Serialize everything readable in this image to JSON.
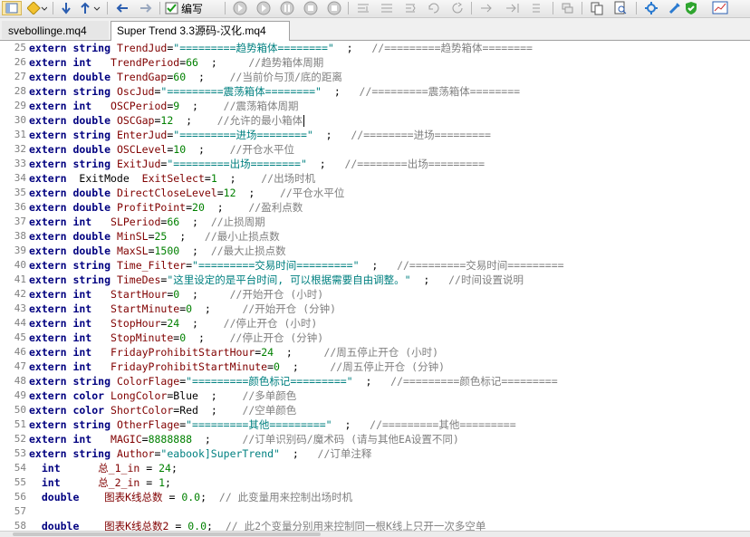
{
  "toolbar": {
    "compile_label": "编写",
    "icons": [
      "navigator-icon",
      "bookmark-icon",
      "arrow-down-icon",
      "arrow-updown-icon",
      "back-icon",
      "forward-icon",
      "compile-icon",
      "run-icon",
      "play-icon",
      "pause-icon",
      "stop-icon",
      "step-into-icon",
      "step-over-icon",
      "step-out-icon",
      "breakpoint-icon",
      "run-to-cursor-icon",
      "copy-icon",
      "search-file-icon",
      "settings-icon",
      "shield-check-icon",
      "chart-icon"
    ]
  },
  "tabs": [
    {
      "label": "svebollinge.mq4",
      "active": false
    },
    {
      "label": "Super Trend 3.3源码-汉化.mq4",
      "active": true
    }
  ],
  "editor": {
    "lines": [
      {
        "n": "25",
        "t": [
          [
            "kw",
            "extern string "
          ],
          [
            "id",
            "TrendJud"
          ],
          [
            "eq",
            "="
          ],
          [
            "str",
            "\"=========趋势箱体========\""
          ],
          [
            "plain",
            "  ;   "
          ],
          [
            "cm",
            "//=========趋势箱体========"
          ]
        ]
      },
      {
        "n": "26",
        "t": [
          [
            "kw",
            "extern int   "
          ],
          [
            "id",
            "TrendPeriod"
          ],
          [
            "eq",
            "="
          ],
          [
            "num",
            "66"
          ],
          [
            "plain",
            "  ;     "
          ],
          [
            "cm",
            "//趋势箱体周期"
          ]
        ]
      },
      {
        "n": "27",
        "t": [
          [
            "kw",
            "extern double "
          ],
          [
            "id",
            "TrendGap"
          ],
          [
            "eq",
            "="
          ],
          [
            "num",
            "60"
          ],
          [
            "plain",
            "  ;    "
          ],
          [
            "cm",
            "//当前价与顶/底的距离"
          ]
        ]
      },
      {
        "n": "28",
        "t": [
          [
            "kw",
            "extern string "
          ],
          [
            "id",
            "OscJud"
          ],
          [
            "eq",
            "="
          ],
          [
            "str",
            "\"=========震荡箱体========\""
          ],
          [
            "plain",
            "  ;   "
          ],
          [
            "cm",
            "//=========震荡箱体========"
          ]
        ]
      },
      {
        "n": "29",
        "t": [
          [
            "kw",
            "extern int   "
          ],
          [
            "id",
            "OSCPeriod"
          ],
          [
            "eq",
            "="
          ],
          [
            "num",
            "9"
          ],
          [
            "plain",
            "  ;    "
          ],
          [
            "cm",
            "//震荡箱体周期"
          ]
        ]
      },
      {
        "n": "30",
        "t": [
          [
            "kw",
            "extern double "
          ],
          [
            "id",
            "OSCGap"
          ],
          [
            "eq",
            "="
          ],
          [
            "num",
            "12"
          ],
          [
            "plain",
            "  ;    "
          ],
          [
            "cm",
            "//允许的最小箱体"
          ]
        ]
      },
      {
        "n": "31",
        "t": [
          [
            "kw",
            "extern string "
          ],
          [
            "id",
            "EnterJud"
          ],
          [
            "eq",
            "="
          ],
          [
            "str",
            "\"=========进场========\""
          ],
          [
            "plain",
            "  ;   "
          ],
          [
            "cm",
            "//========进场========="
          ]
        ]
      },
      {
        "n": "32",
        "t": [
          [
            "kw",
            "extern double "
          ],
          [
            "id",
            "OSCLevel"
          ],
          [
            "eq",
            "="
          ],
          [
            "num",
            "10"
          ],
          [
            "plain",
            "  ;    "
          ],
          [
            "cm",
            "//开仓水平位"
          ]
        ]
      },
      {
        "n": "33",
        "t": [
          [
            "kw",
            "extern string "
          ],
          [
            "id",
            "ExitJud"
          ],
          [
            "eq",
            "="
          ],
          [
            "str",
            "\"=========出场========\""
          ],
          [
            "plain",
            "  ;   "
          ],
          [
            "cm",
            "//========出场========="
          ]
        ]
      },
      {
        "n": "34",
        "t": [
          [
            "kw",
            "extern "
          ],
          [
            "plain",
            " ExitMode  "
          ],
          [
            "id",
            "ExitSelect"
          ],
          [
            "eq",
            "="
          ],
          [
            "num",
            "1"
          ],
          [
            "plain",
            "  ;    "
          ],
          [
            "cm",
            "//出场时机"
          ]
        ]
      },
      {
        "n": "35",
        "t": [
          [
            "kw",
            "extern double "
          ],
          [
            "id",
            "DirectCloseLevel"
          ],
          [
            "eq",
            "="
          ],
          [
            "num",
            "12"
          ],
          [
            "plain",
            "  ;    "
          ],
          [
            "cm",
            "//平仓水平位"
          ]
        ]
      },
      {
        "n": "36",
        "t": [
          [
            "kw",
            "extern double "
          ],
          [
            "id",
            "ProfitPoint"
          ],
          [
            "eq",
            "="
          ],
          [
            "num",
            "20"
          ],
          [
            "plain",
            "  ;    "
          ],
          [
            "cm",
            "//盈利点数"
          ]
        ]
      },
      {
        "n": "37",
        "t": [
          [
            "kw",
            "extern int   "
          ],
          [
            "id",
            "SLPeriod"
          ],
          [
            "eq",
            "="
          ],
          [
            "num",
            "66"
          ],
          [
            "plain",
            "  ;  "
          ],
          [
            "cm",
            "//止损周期"
          ]
        ]
      },
      {
        "n": "38",
        "t": [
          [
            "kw",
            "extern double "
          ],
          [
            "id",
            "MinSL"
          ],
          [
            "eq",
            "="
          ],
          [
            "num",
            "25"
          ],
          [
            "plain",
            "  ;   "
          ],
          [
            "cm",
            "//最小止损点数"
          ]
        ]
      },
      {
        "n": "39",
        "t": [
          [
            "kw",
            "extern double "
          ],
          [
            "id",
            "MaxSL"
          ],
          [
            "eq",
            "="
          ],
          [
            "num",
            "1500"
          ],
          [
            "plain",
            "  ;  "
          ],
          [
            "cm",
            "//最大止损点数"
          ]
        ]
      },
      {
        "n": "40",
        "t": [
          [
            "kw",
            "extern string "
          ],
          [
            "id",
            "Time_Filter"
          ],
          [
            "eq",
            "="
          ],
          [
            "str",
            "\"=========交易时间=========\""
          ],
          [
            "plain",
            "  ;   "
          ],
          [
            "cm",
            "//=========交易时间========="
          ]
        ]
      },
      {
        "n": "41",
        "t": [
          [
            "kw",
            "extern string "
          ],
          [
            "id",
            "TimeDes"
          ],
          [
            "eq",
            "="
          ],
          [
            "str",
            "\"这里设定的是平台时间, 可以根据需要自由调整。\""
          ],
          [
            "plain",
            "  ;   "
          ],
          [
            "cm",
            "//时间设置说明"
          ]
        ]
      },
      {
        "n": "42",
        "t": [
          [
            "kw",
            "extern int   "
          ],
          [
            "id",
            "StartHour"
          ],
          [
            "eq",
            "="
          ],
          [
            "num",
            "0"
          ],
          [
            "plain",
            "  ;     "
          ],
          [
            "cm",
            "//开始开仓 (小时)"
          ]
        ]
      },
      {
        "n": "43",
        "t": [
          [
            "kw",
            "extern int   "
          ],
          [
            "id",
            "StartMinute"
          ],
          [
            "eq",
            "="
          ],
          [
            "num",
            "0"
          ],
          [
            "plain",
            "  ;     "
          ],
          [
            "cm",
            "//开始开仓 (分钟)"
          ]
        ]
      },
      {
        "n": "44",
        "t": [
          [
            "kw",
            "extern int   "
          ],
          [
            "id",
            "StopHour"
          ],
          [
            "eq",
            "="
          ],
          [
            "num",
            "24"
          ],
          [
            "plain",
            "  ;    "
          ],
          [
            "cm",
            "//停止开仓 (小时)"
          ]
        ]
      },
      {
        "n": "45",
        "t": [
          [
            "kw",
            "extern int   "
          ],
          [
            "id",
            "StopMinute"
          ],
          [
            "eq",
            "="
          ],
          [
            "num",
            "0"
          ],
          [
            "plain",
            "  ;    "
          ],
          [
            "cm",
            "//停止开仓 (分钟)"
          ]
        ]
      },
      {
        "n": "46",
        "t": [
          [
            "kw",
            "extern int   "
          ],
          [
            "id",
            "FridayProhibitStartHour"
          ],
          [
            "eq",
            "="
          ],
          [
            "num",
            "24"
          ],
          [
            "plain",
            "  ;     "
          ],
          [
            "cm",
            "//周五停止开仓 (小时)"
          ]
        ]
      },
      {
        "n": "47",
        "t": [
          [
            "kw",
            "extern int   "
          ],
          [
            "id",
            "FridayProhibitStartMinute"
          ],
          [
            "eq",
            "="
          ],
          [
            "num",
            "0"
          ],
          [
            "plain",
            "  ;     "
          ],
          [
            "cm",
            "//周五停止开仓 (分钟)"
          ]
        ]
      },
      {
        "n": "48",
        "t": [
          [
            "kw",
            "extern string "
          ],
          [
            "id",
            "ColorFlage"
          ],
          [
            "eq",
            "="
          ],
          [
            "str",
            "\"=========颜色标记=========\""
          ],
          [
            "plain",
            "  ;   "
          ],
          [
            "cm",
            "//=========颜色标记========="
          ]
        ]
      },
      {
        "n": "49",
        "t": [
          [
            "kw",
            "extern color "
          ],
          [
            "id",
            "LongColor"
          ],
          [
            "eq",
            "="
          ],
          [
            "plain",
            "Blue  ;    "
          ],
          [
            "cm",
            "//多单颜色"
          ]
        ]
      },
      {
        "n": "50",
        "t": [
          [
            "kw",
            "extern color "
          ],
          [
            "id",
            "ShortColor"
          ],
          [
            "eq",
            "="
          ],
          [
            "plain",
            "Red  ;    "
          ],
          [
            "cm",
            "//空单颜色"
          ]
        ]
      },
      {
        "n": "51",
        "t": [
          [
            "kw",
            "extern string "
          ],
          [
            "id",
            "OtherFlage"
          ],
          [
            "eq",
            "="
          ],
          [
            "str",
            "\"=========其他=========\""
          ],
          [
            "plain",
            "  ;   "
          ],
          [
            "cm",
            "//=========其他========="
          ]
        ]
      },
      {
        "n": "52",
        "t": [
          [
            "kw",
            "extern int   "
          ],
          [
            "id",
            "MAGIC"
          ],
          [
            "eq",
            "="
          ],
          [
            "num",
            "8888888"
          ],
          [
            "plain",
            "  ;     "
          ],
          [
            "cm",
            "//订单识别码/魔术码 (请与其他EA设置不同)"
          ]
        ]
      },
      {
        "n": "53",
        "t": [
          [
            "kw",
            "extern string "
          ],
          [
            "id",
            "Author"
          ],
          [
            "eq",
            "="
          ],
          [
            "str",
            "\"eabook]SuperTrend\""
          ],
          [
            "plain",
            "  ;   "
          ],
          [
            "cm",
            "//订单注释"
          ]
        ]
      },
      {
        "n": "54",
        "t": [
          [
            "plain",
            "  "
          ],
          [
            "kw",
            "int"
          ],
          [
            "plain",
            "      "
          ],
          [
            "id",
            "总_1_in"
          ],
          [
            "plain",
            " = "
          ],
          [
            "num",
            "24"
          ],
          [
            "plain",
            ";"
          ]
        ]
      },
      {
        "n": "55",
        "t": [
          [
            "plain",
            "  "
          ],
          [
            "kw",
            "int"
          ],
          [
            "plain",
            "      "
          ],
          [
            "id",
            "总_2_in"
          ],
          [
            "plain",
            " = "
          ],
          [
            "num",
            "1"
          ],
          [
            "plain",
            ";"
          ]
        ]
      },
      {
        "n": "56",
        "t": [
          [
            "plain",
            "  "
          ],
          [
            "kw",
            "double"
          ],
          [
            "plain",
            "    "
          ],
          [
            "id",
            "图表K线总数"
          ],
          [
            "plain",
            " = "
          ],
          [
            "num",
            "0.0"
          ],
          [
            "plain",
            ";  "
          ],
          [
            "cm",
            "// 此变量用来控制出场时机"
          ]
        ]
      },
      {
        "n": "57",
        "t": []
      },
      {
        "n": "58",
        "t": [
          [
            "plain",
            "  "
          ],
          [
            "kw",
            "double"
          ],
          [
            "plain",
            "    "
          ],
          [
            "id",
            "图表K线总数2"
          ],
          [
            "plain",
            " = "
          ],
          [
            "num",
            "0.0"
          ],
          [
            "plain",
            ";  "
          ],
          [
            "cm",
            "// 此2个变量分别用来控制同一根K线上只开一次多空单"
          ]
        ]
      }
    ]
  }
}
